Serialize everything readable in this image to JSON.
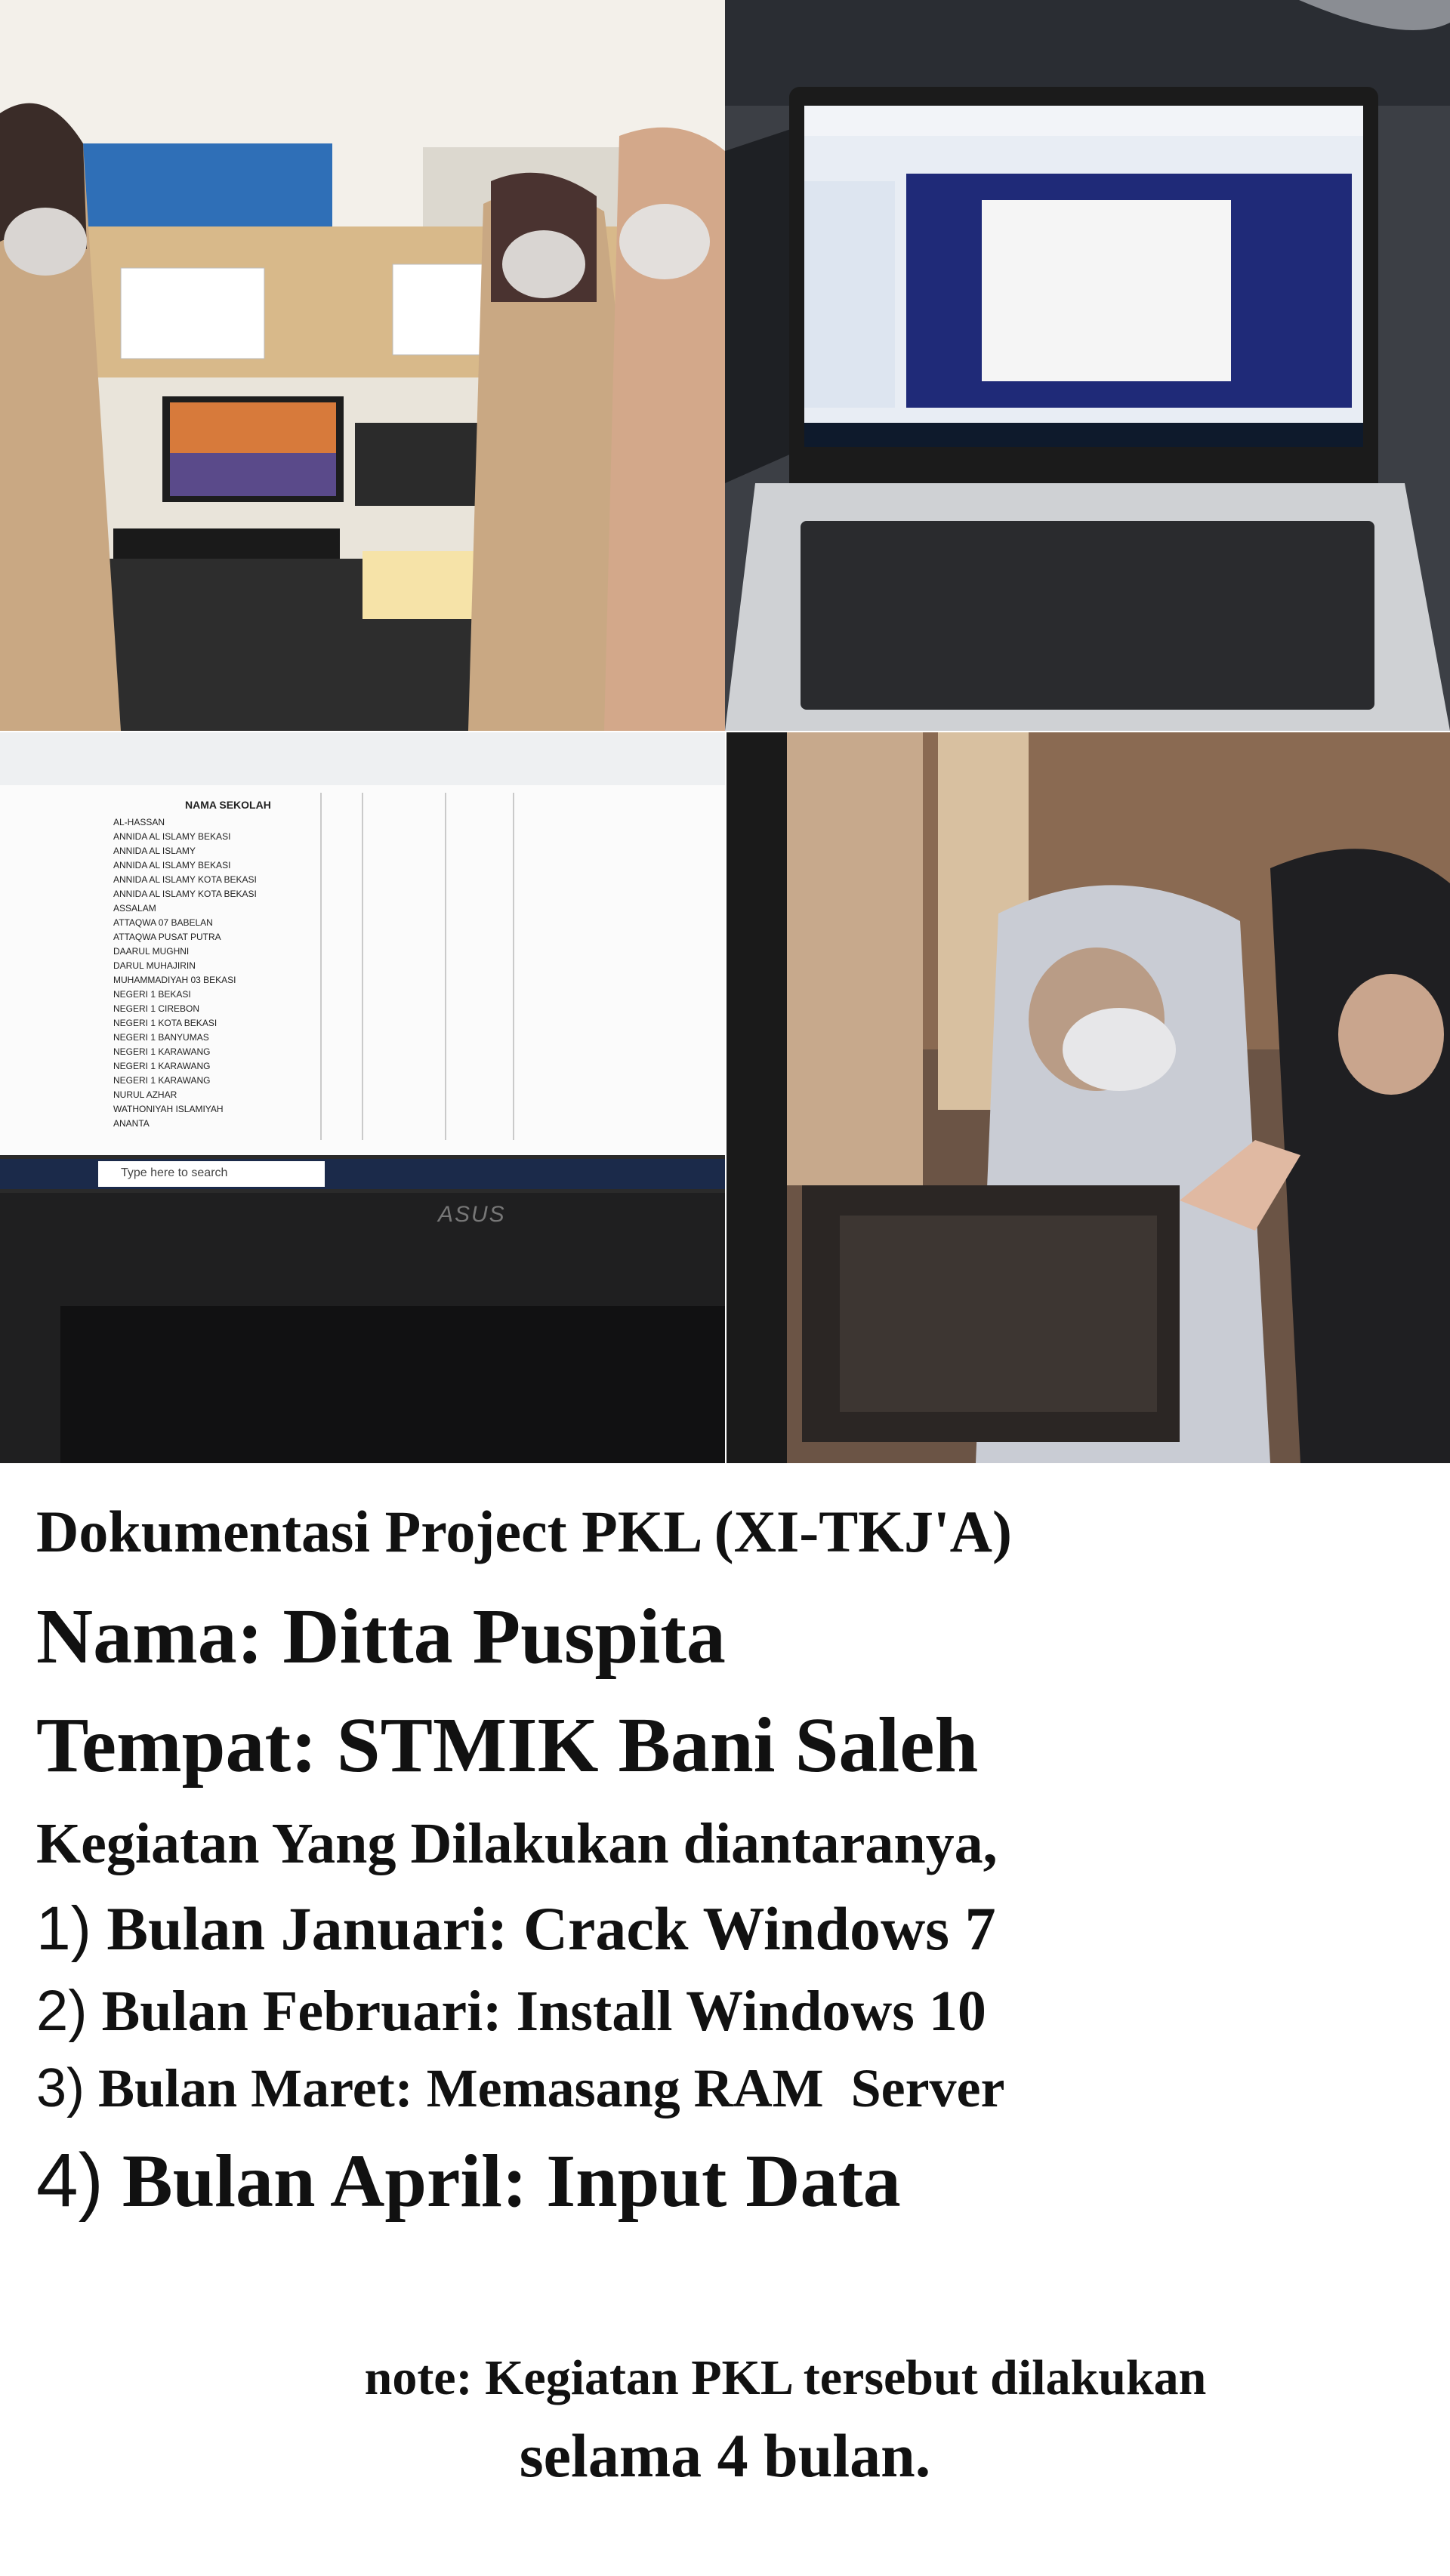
{
  "photos": {
    "top_left": {
      "desc_icon": "classroom-photo"
    },
    "top_right": {
      "desc_icon": "laptop-photo"
    },
    "bottom_left": {
      "desc_icon": "spreadsheet-photo"
    },
    "bottom_right": {
      "desc_icon": "server-photo"
    }
  },
  "spreadsheet": {
    "header": "NAMA SEKOLAH",
    "rows": [
      "AL-HASSAN",
      "ANNIDA AL ISLAMY BEKASI",
      "ANNIDA AL ISLAMY",
      "ANNIDA AL ISLAMY BEKASI",
      "ANNIDA AL ISLAMY KOTA BEKASI",
      "ANNIDA AL ISLAMY KOTA BEKASI",
      "ASSALAM",
      "ATTAQWA 07 BABELAN",
      "ATTAQWA PUSAT PUTRA",
      "DAARUL MUGHNI",
      "DARUL MUHAJIRIN",
      "MUHAMMADIYAH 03 BEKASI",
      "NEGERI 1 BEKASI",
      "NEGERI 1 CIREBON",
      "NEGERI 1 KOTA BEKASI",
      "NEGERI 1 BANYUMAS",
      "NEGERI 1 KARAWANG",
      "NEGERI 1 KARAWANG",
      "NEGERI 1 KARAWANG",
      "NURUL AZHAR",
      "WATHONIYAH ISLAMIYAH",
      "ANANTA"
    ],
    "taskbar_search": "Type here to search",
    "brand": "ASUS"
  },
  "text": {
    "title": "Dokumentasi Project PKL (XI-TKJ'A)",
    "nama_label": "Nama",
    "nama_value": "Ditta Puspita",
    "tempat_label": "Tempat",
    "tempat_value": "STMIK Bani Saleh",
    "intro": "Kegiatan Yang Dilakukan diantaranya,",
    "items": [
      {
        "num": "1)",
        "label": "Bulan Januari",
        "value": "Crack Windows 7"
      },
      {
        "num": "2)",
        "label": "Bulan Februari",
        "value": "Install Windows 10"
      },
      {
        "num": "3)",
        "label": "Bulan Maret",
        "value": "Memasang RAM  Server"
      },
      {
        "num": "4)",
        "label": "Bulan April",
        "value": "Input Data"
      }
    ],
    "note_line1": "note: Kegiatan PKL tersebut dilakukan",
    "note_line2": "selama 4 bulan."
  }
}
